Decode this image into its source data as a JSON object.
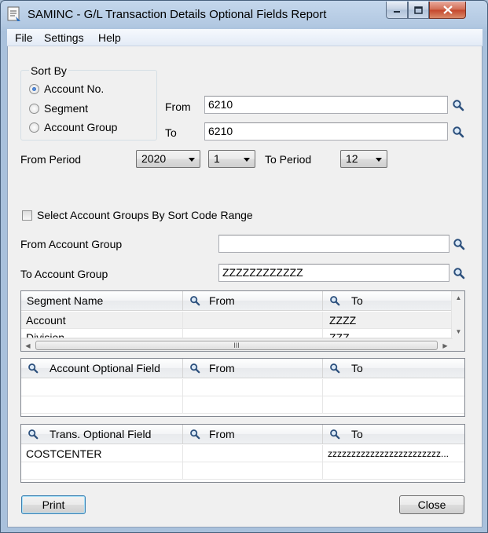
{
  "window": {
    "title": "SAMINC - G/L Transaction Details Optional Fields Report",
    "controls": {
      "minimize": "minimize",
      "maximize": "maximize",
      "close": "close"
    }
  },
  "menu": {
    "items": [
      "File",
      "Settings",
      "Help"
    ]
  },
  "sort_by": {
    "title": "Sort By",
    "options": [
      "Account No.",
      "Segment",
      "Account Group"
    ],
    "selected": "Account No."
  },
  "range": {
    "from_label": "From",
    "from_value": "6210",
    "to_label": "To",
    "to_value": "6210"
  },
  "period": {
    "from_label": "From Period",
    "from_year": "2020",
    "from_period": "1",
    "to_label": "To Period",
    "to_period": "12"
  },
  "account_groups": {
    "checkbox_label": "Select Account Groups By Sort Code Range",
    "checked": false,
    "from_label": "From Account Group",
    "from_value": "",
    "to_label": "To Account Group",
    "to_value": "ZZZZZZZZZZZZ"
  },
  "segment_grid": {
    "headers": [
      "Segment Name",
      "From",
      "To"
    ],
    "rows": [
      {
        "name": "Account",
        "from": "",
        "to": "ZZZZ"
      },
      {
        "name": "Division",
        "from": "",
        "to": "ZZZ"
      }
    ],
    "hscroll_grip": "III"
  },
  "account_optional_grid": {
    "headers": [
      "Account Optional Field",
      "From",
      "To"
    ],
    "rows": []
  },
  "trans_optional_grid": {
    "headers": [
      "Trans. Optional Field",
      "From",
      "To"
    ],
    "rows": [
      {
        "name": "COSTCENTER",
        "from": "",
        "to": "zzzzzzzzzzzzzzzzzzzzzzzz..."
      }
    ]
  },
  "buttons": {
    "print": "Print",
    "close": "Close"
  },
  "colors": {
    "title_bar": "#b3c9e2",
    "client_bg": "#f0f0f0",
    "close_button": "#c4452b"
  }
}
